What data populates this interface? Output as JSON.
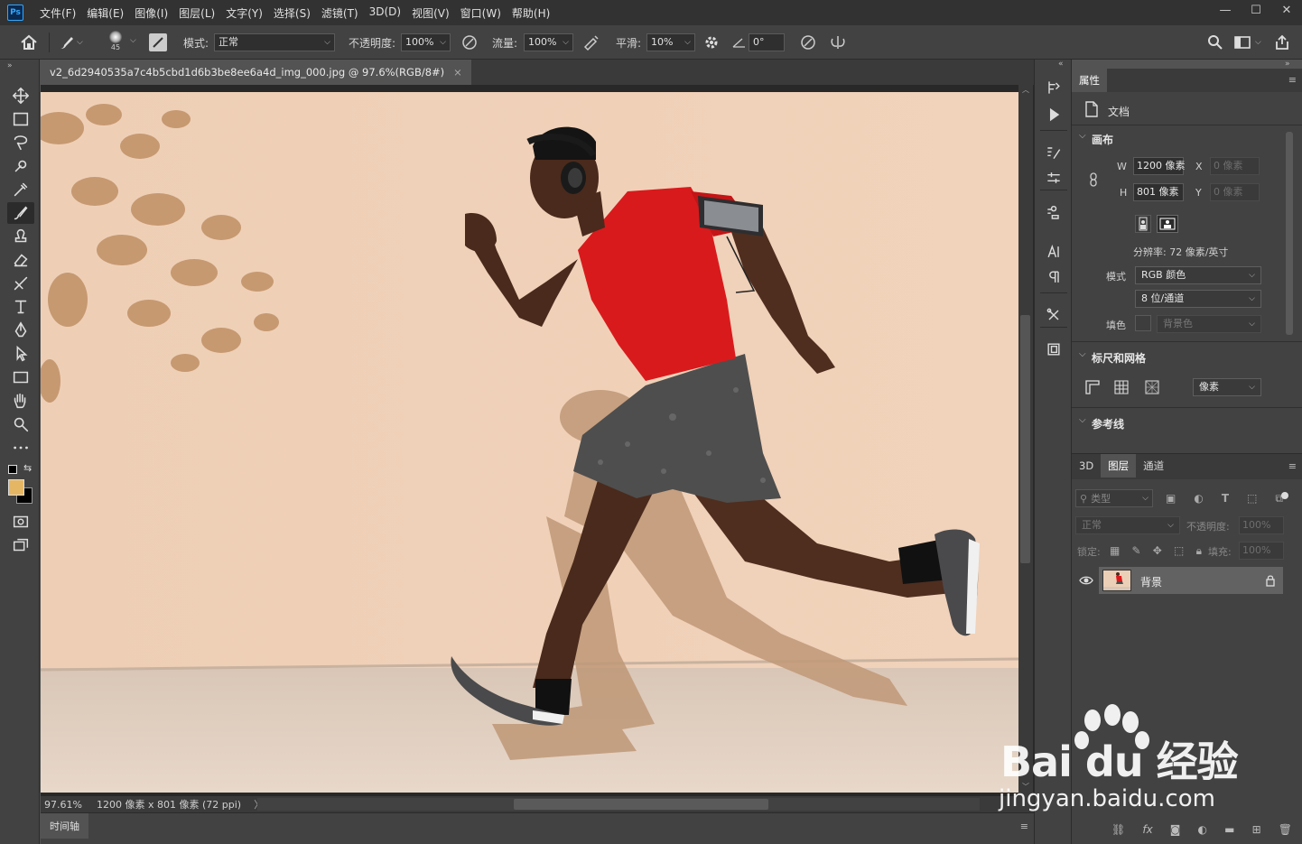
{
  "app": {
    "logo": "Ps"
  },
  "menu": [
    "文件(F)",
    "编辑(E)",
    "图像(I)",
    "图层(L)",
    "文字(Y)",
    "选择(S)",
    "滤镜(T)",
    "3D(D)",
    "视图(V)",
    "窗口(W)",
    "帮助(H)"
  ],
  "window_controls": {
    "minimize": "—",
    "maximize": "☐",
    "close": "✕"
  },
  "options": {
    "brush_size": "45",
    "mode_label": "模式:",
    "mode_value": "正常",
    "opacity_label": "不透明度:",
    "opacity_value": "100%",
    "flow_label": "流量:",
    "flow_value": "100%",
    "smooth_label": "平滑:",
    "smooth_value": "10%",
    "angle_value": "0°"
  },
  "document": {
    "tab_title": "v2_6d2940535a7c4b5cbd1d6b3be8ee6a4d_img_000.jpg @ 97.6%(RGB/8#)",
    "tab_close": "×",
    "zoom": "97.61%",
    "size_info": "1200 像素 x 801 像素 (72 ppi)",
    "status_arrow": "〉"
  },
  "timeline": {
    "label": "时间轴"
  },
  "properties": {
    "tab": "属性",
    "doc_label": "文档",
    "canvas_section": "画布",
    "w_label": "W",
    "w_value": "1200 像素",
    "x_label": "X",
    "x_value": "0 像素",
    "h_label": "H",
    "h_value": "801 像素",
    "y_label": "Y",
    "y_value": "0 像素",
    "resolution": "分辨率: 72 像素/英寸",
    "mode_label": "模式",
    "mode_value": "RGB 颜色",
    "depth_value": "8 位/通道",
    "fill_label": "填色",
    "fill_value": "背景色",
    "rulers_section": "标尺和网格",
    "units_value": "像素",
    "guides_section": "参考线"
  },
  "layers": {
    "tabs": [
      "3D",
      "图层",
      "通道"
    ],
    "active_tab": 1,
    "search_placeholder": "类型",
    "blend_mode": "正常",
    "opacity_label": "不透明度:",
    "opacity_value": "100%",
    "lock_label": "锁定:",
    "fill_label": "填充:",
    "fill_value": "100%",
    "layer_name": "背景"
  },
  "colors": {
    "foreground": "#e5b764",
    "background": "#000000",
    "accent": "#31a8ff"
  },
  "watermark": {
    "brand": "Bai du 经验",
    "url": "jingyan.baidu.com"
  }
}
